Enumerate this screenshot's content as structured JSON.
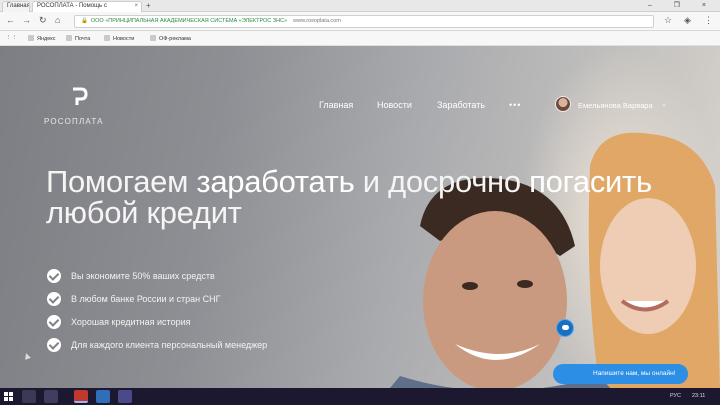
{
  "browser": {
    "tab_inactive": "Главная",
    "tab_active": "РОСОПЛАТА - Помощь с",
    "tab_close": "×",
    "new_tab": "+",
    "window_controls": "– ❐ ×",
    "address_secure_label": "ООО «ПРИНЦИПАЛЬНАЯ АКАДЕМИЧЕСКАЯ СИСТЕМА «ЭЛЕКТРОС ЗНС»",
    "address_url": "www.rosoplata.com",
    "bookmarks": [
      "Яндекс",
      "Почта",
      "Новости",
      "ОФ-реклама"
    ]
  },
  "site": {
    "logo_text": "РОСОПЛАТА",
    "nav": [
      "Главная",
      "Новости",
      "Заработать"
    ],
    "nav_more": "•••",
    "user_name": "Емельянова Варвара",
    "user_caret": "⌄",
    "headline": {
      "p1": "Помогаем ",
      "p2": "заработать",
      "p3": " и досрочно ",
      "p4": "погасить",
      "line2": "любой кредит"
    },
    "bullets": [
      "Вы экономите 50% ваших средств",
      "В любом банке России и стран СНГ",
      "Хорошая кредитная история",
      "Для каждого клиента персональный менеджер"
    ],
    "chat_text": "Напишите нам, мы онлайн!"
  },
  "taskbar": {
    "tray_lang": "РУС",
    "tray_time": "23:11"
  },
  "colors": {
    "chat_accent": "#2d8ee6",
    "taskbar": "#1b1830",
    "secure_green": "#2b8a3e"
  }
}
